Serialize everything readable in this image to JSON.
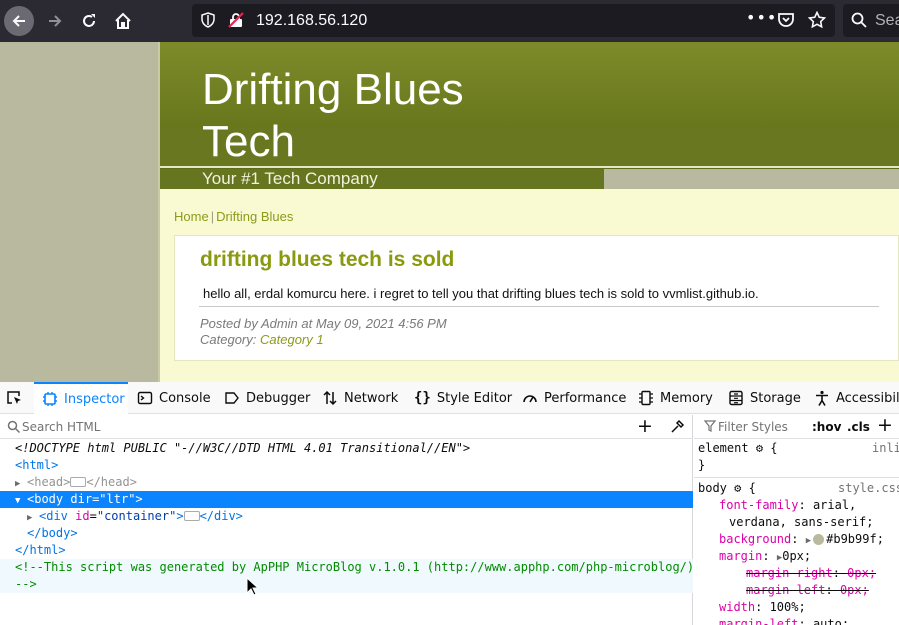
{
  "browser": {
    "url": "192.168.56.120",
    "search_placeholder": "Sea",
    "more_label": "•••"
  },
  "page": {
    "site_title": "Drifting Blues Tech",
    "tagline": "Your #1 Tech Company",
    "breadcrumb_home": "Home",
    "breadcrumb_current": "Drifting Blues",
    "post_title": "drifting blues tech is sold",
    "post_body": "hello all, erdal komurcu here. i regret to tell you that drifting blues tech is sold to vvmlist.github.io.",
    "posted_by": "Posted by Admin at May 09, 2021 4:56 PM",
    "category_label": "Category:",
    "category_value": "Category 1",
    "colors": {
      "header_green": "#6b7a1e",
      "background": "#b9b99f",
      "content_bg": "#fafad2",
      "accent": "#8a9a10"
    }
  },
  "devtools": {
    "tabs": [
      {
        "label": "Inspector",
        "icon": "inspector-icon",
        "active": true
      },
      {
        "label": "Console",
        "icon": "console-icon"
      },
      {
        "label": "Debugger",
        "icon": "debugger-icon"
      },
      {
        "label": "Network",
        "icon": "network-icon"
      },
      {
        "label": "Style Editor",
        "icon": "style-editor-icon"
      },
      {
        "label": "Performance",
        "icon": "performance-icon"
      },
      {
        "label": "Memory",
        "icon": "memory-icon"
      },
      {
        "label": "Storage",
        "icon": "storage-icon"
      },
      {
        "label": "Accessibili",
        "icon": "accessibility-icon"
      }
    ],
    "search_html_placeholder": "Search HTML",
    "markup": {
      "doctype": "<!DOCTYPE html PUBLIC \"-//W3C//DTD HTML 4.01 Transitional//EN\">",
      "html_open": "<html>",
      "head_open": "<head>",
      "head_close": "</head>",
      "body_tag": "body",
      "body_attr_name": "dir",
      "body_attr_value": "\"ltr\"",
      "div_tag": "div",
      "div_attr_name": "id",
      "div_attr_value": "\"container\"",
      "div_close": "</div>",
      "body_close": "</body>",
      "html_close": "</html>",
      "comment_line1": "<!--This script was generated by ApPHP MicroBlog v.1.0.1 (http://www.apphp.com/php-microblog/)",
      "comment_line2": "-->"
    },
    "rules": {
      "filter_placeholder": "Filter Styles",
      "hov": ":hov",
      "cls": ".cls",
      "element_selector": "element",
      "element_source": "inli",
      "body_selector": "body",
      "body_source": "style.css",
      "font_family_name": "font-family",
      "font_family_value1": "arial,",
      "font_family_value2": "verdana, sans-serif;",
      "background_name": "background",
      "background_value": "#b9b99f;",
      "margin_name": "margin",
      "margin_value": "0px;",
      "margin_right_name": "margin-right",
      "margin_right_value": "0px;",
      "margin_left_name": "margin-left",
      "margin_left_value": "0px;",
      "width_name": "width",
      "width_value": "100%;",
      "margin_left2_name": "margin-left",
      "margin_left2_value": "auto;"
    }
  }
}
